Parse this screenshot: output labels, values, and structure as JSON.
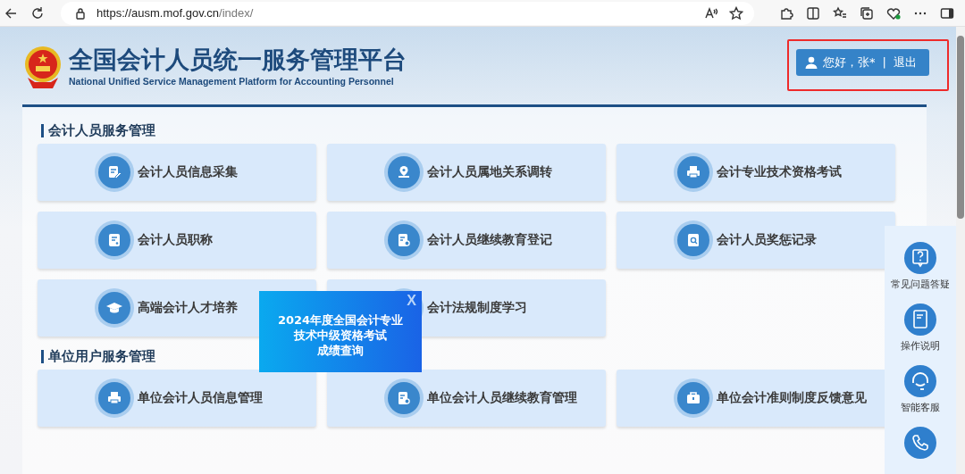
{
  "browser": {
    "url_host": "https://ausm.mof.gov.cn",
    "url_path": "/index/"
  },
  "header": {
    "title": "全国会计人员统一服务管理平台",
    "subtitle": "National Unified Service Management Platform for Accounting Personnel"
  },
  "user": {
    "greeting": "您好，张*",
    "separator": "|",
    "logout": "退出",
    "highlighted": true
  },
  "sections": [
    {
      "title": "会计人员服务管理",
      "items": [
        {
          "label": "会计人员信息采集"
        },
        {
          "label": "会计人员属地关系调转"
        },
        {
          "label": "会计专业技术资格考试"
        },
        {
          "label": "会计人员职称"
        },
        {
          "label": "会计人员继续教育登记"
        },
        {
          "label": "会计人员奖惩记录"
        },
        {
          "label": "高端会计人才培养"
        },
        {
          "label": "会计法规制度学习"
        }
      ]
    },
    {
      "title": "单位用户服务管理",
      "items": [
        {
          "label": "单位会计人员信息管理"
        },
        {
          "label": "单位会计人员继续教育管理"
        },
        {
          "label": "单位会计准则制度反馈意见"
        }
      ]
    }
  ],
  "popup": {
    "lines": [
      "2024年度全国会计专业",
      "技术中级资格考试",
      "成绩查询"
    ],
    "close": "X"
  },
  "side_panel": [
    {
      "label": "常见问题答疑"
    },
    {
      "label": "操作说明"
    },
    {
      "label": "智能客服"
    }
  ]
}
